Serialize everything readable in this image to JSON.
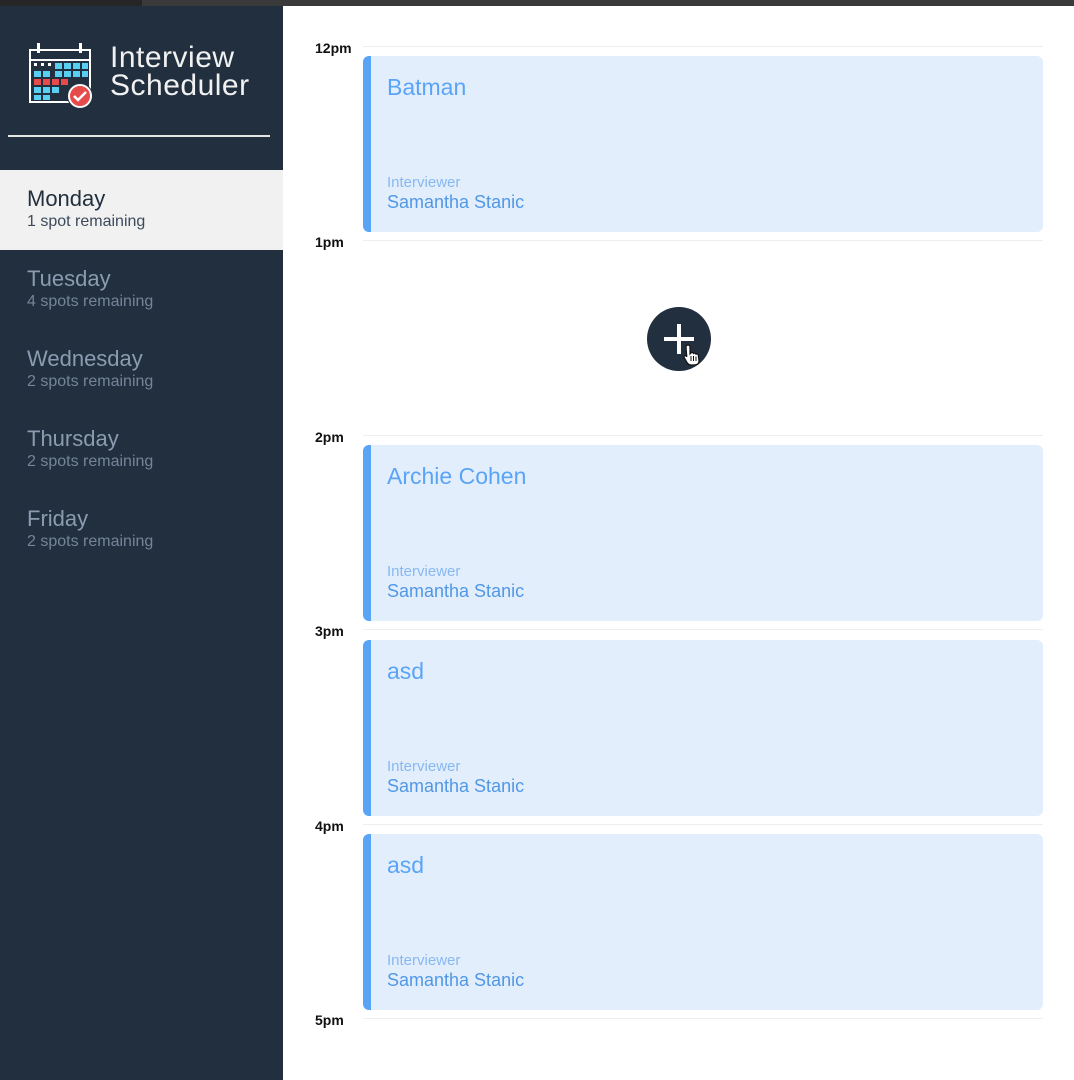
{
  "app": {
    "title_line1": "Interview",
    "title_line2": "Scheduler"
  },
  "days": [
    {
      "name": "Monday",
      "spots": "1 spot remaining",
      "selected": true
    },
    {
      "name": "Tuesday",
      "spots": "4 spots remaining",
      "selected": false
    },
    {
      "name": "Wednesday",
      "spots": "2 spots remaining",
      "selected": false
    },
    {
      "name": "Thursday",
      "spots": "2 spots remaining",
      "selected": false
    },
    {
      "name": "Friday",
      "spots": "2 spots remaining",
      "selected": false
    }
  ],
  "times": [
    "12pm",
    "1pm",
    "2pm",
    "3pm",
    "4pm",
    "5pm"
  ],
  "appointments": [
    {
      "time": "12pm",
      "student": "Batman",
      "interviewer_label": "Interviewer",
      "interviewer": "Samantha Stanic"
    },
    {
      "time": "1pm",
      "empty": true
    },
    {
      "time": "2pm",
      "student": "Archie Cohen",
      "interviewer_label": "Interviewer",
      "interviewer": "Samantha Stanic"
    },
    {
      "time": "3pm",
      "student": "asd",
      "interviewer_label": "Interviewer",
      "interviewer": "Samantha Stanic"
    },
    {
      "time": "4pm",
      "student": "asd",
      "interviewer_label": "Interviewer",
      "interviewer": "Samantha Stanic"
    }
  ],
  "icons": {
    "logo": "calendar-check-icon",
    "add": "plus-icon",
    "cursor": "hand-pointer-icon"
  },
  "colors": {
    "sidebar_bg": "#222f3e",
    "selected_day_bg": "#f1f1f1",
    "card_bg": "#e3eefc",
    "card_accent": "#5aa4f8",
    "logo_check": "#e64a4a"
  }
}
